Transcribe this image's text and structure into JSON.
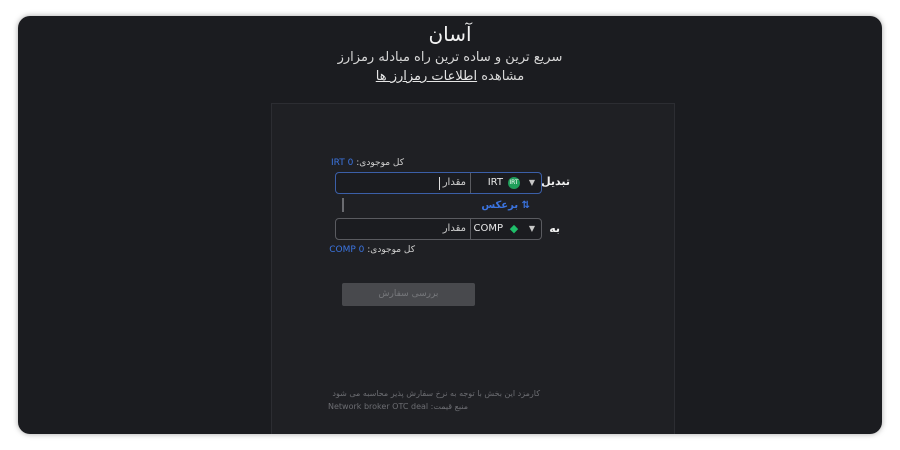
{
  "header": {
    "title": "آسان",
    "subtitle": "سریع ترین و ساده ترین راه مبادله رمزارز",
    "info_prefix": "مشاهده",
    "info_link": "اطلاعات رمزارز ها"
  },
  "form": {
    "from": {
      "balance_label": "کل موجودی:",
      "balance_value": "0 IRT",
      "label": "تبدیل",
      "currency": "IRT",
      "coin_badge": "IRT",
      "amount_placeholder": "مقدار"
    },
    "swap_label": "برعکس",
    "swap_icon": "⇅",
    "to": {
      "label": "به",
      "currency": "COMP",
      "coin_badge": "◆",
      "amount_placeholder": "مقدار",
      "balance_label": "کل موجودی:",
      "balance_value": "0 COMP"
    },
    "submit_label": "بررسی سفارش"
  },
  "footer": {
    "note_line1": "کارمزد این بخش با توجه به نرخ سفارش پذیر محاسبه می شود",
    "note_line2_label": "منبع قیمت:",
    "note_line2_value": "Network broker OTC deal"
  },
  "colors": {
    "background": "#1b1c20",
    "accent": "#3b74e0",
    "irt_coin": "#1f9e5a",
    "comp_coin": "#1fbf6a"
  },
  "icons": {
    "dropdown": "chevron-down-icon",
    "swap": "swap-icon"
  }
}
